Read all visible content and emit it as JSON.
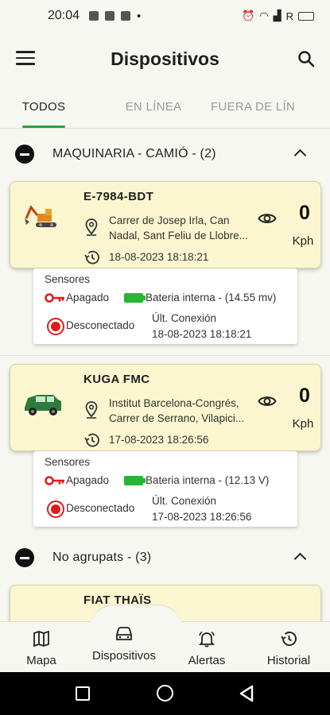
{
  "status_bar": {
    "time": "20:04",
    "right_label": "R"
  },
  "app_bar": {
    "title": "Dispositivos"
  },
  "tabs": [
    {
      "label": "TODOS",
      "active": true
    },
    {
      "label": "EN LÍNEA",
      "active": false
    },
    {
      "label": "FUERA DE LÍN",
      "active": false
    }
  ],
  "groups": [
    {
      "label": "MAQUINARIA - CAMIÓ - (2)",
      "devices": [
        {
          "name": "E-7984-BDT",
          "address_line1": "Carrer de Josep Irla, Can",
          "address_line2": "Nadal, Sant Feliu de Llobre...",
          "date": "18-08-2023 18:18:21",
          "speed": "0",
          "unit": "Kph",
          "sensors": {
            "title": "Sensores",
            "ignition": "Apagado",
            "battery": "Bateria interna - (14.55 mv)",
            "connection": "Desconectado",
            "last_conn_label": "Últ. Conexión",
            "last_conn_date": "18-08-2023 18:18:21"
          }
        },
        {
          "name": "KUGA FMC",
          "address_line1": "Institut Barcelona-Congrés,",
          "address_line2": "Carrer de Serrano, Vilapici...",
          "date": "17-08-2023 18:26:56",
          "speed": "0",
          "unit": "Kph",
          "sensors": {
            "title": "Sensores",
            "ignition": "Apagado",
            "battery": "Bateria interna - (12.13 V)",
            "connection": "Desconectado",
            "last_conn_label": "Últ. Conexión",
            "last_conn_date": "17-08-2023 18:26:56"
          }
        }
      ]
    },
    {
      "label": "No agrupats - (3)",
      "devices": [
        {
          "name": "FIAT THAÏS"
        }
      ]
    }
  ],
  "bottom_nav": [
    {
      "label": "Mapa",
      "icon": "map-icon"
    },
    {
      "label": "Dispositivos",
      "icon": "car-icon"
    },
    {
      "label": "Alertas",
      "icon": "bell-icon"
    },
    {
      "label": "Historial",
      "icon": "history-icon"
    }
  ],
  "colors": {
    "card_bg": "#fbf6cf",
    "accent_green": "#2e9e3e",
    "alert_red": "#e01b1b",
    "battery_green": "#28b435"
  }
}
